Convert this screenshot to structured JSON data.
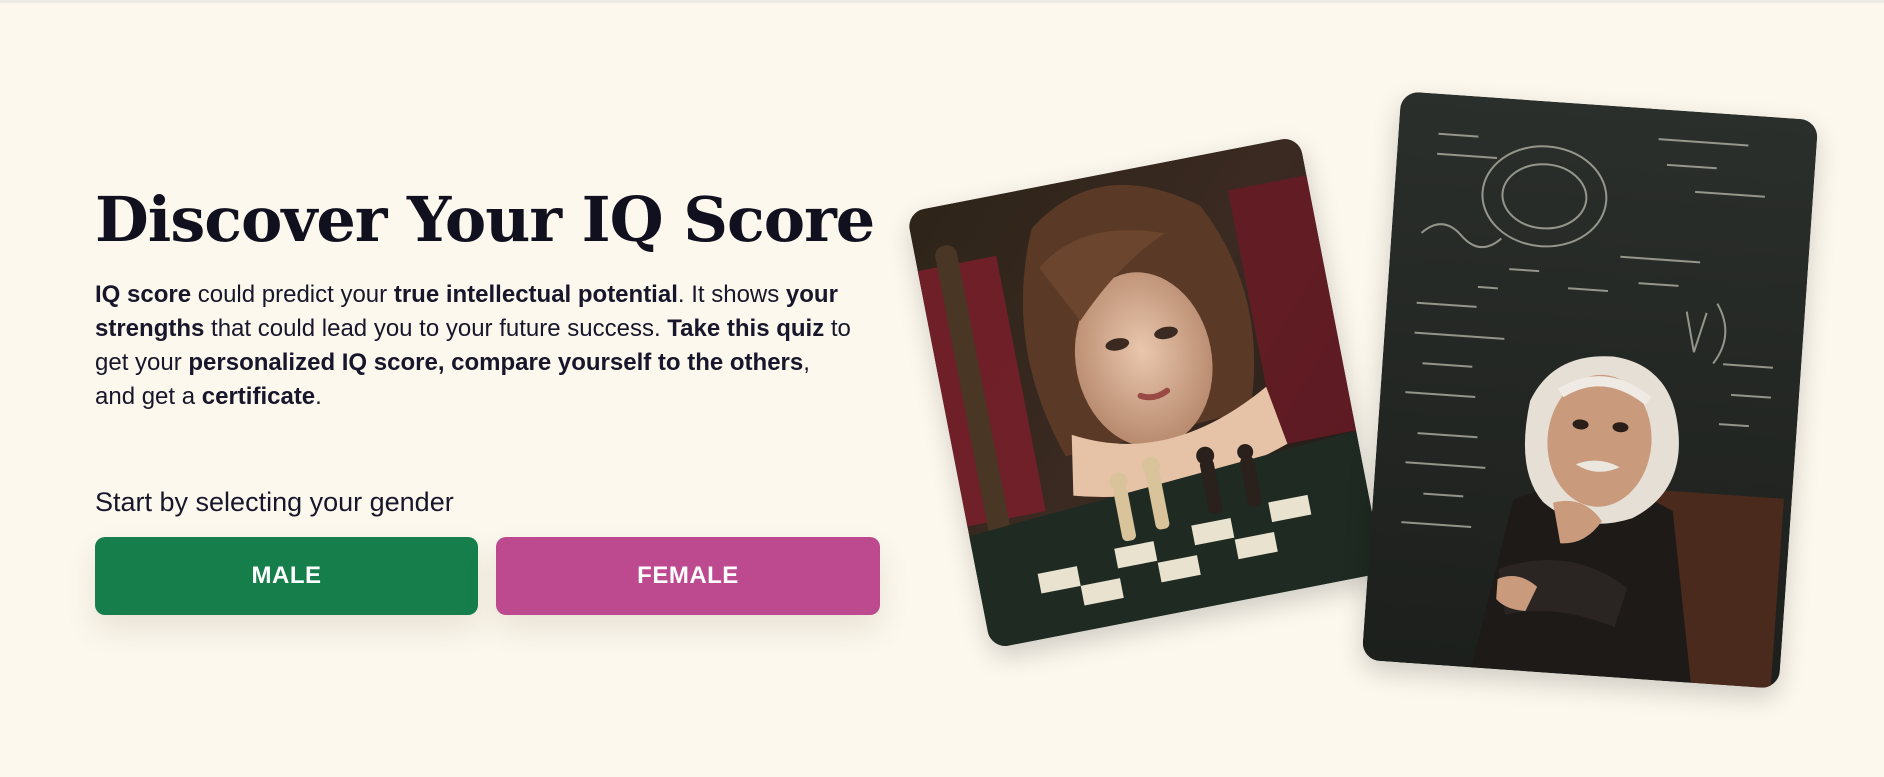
{
  "hero": {
    "title": "Discover Your IQ Score",
    "intro": [
      {
        "text": "IQ score",
        "bold": true
      },
      {
        "text": " could predict your ",
        "bold": false
      },
      {
        "text": "true intellectual potential",
        "bold": true
      },
      {
        "text": ". It shows ",
        "bold": false
      },
      {
        "text": "your strengths",
        "bold": true
      },
      {
        "text": " that could lead you to your future success. ",
        "bold": false
      },
      {
        "text": "Take this quiz",
        "bold": true
      },
      {
        "text": " to get your ",
        "bold": false
      },
      {
        "text": "personalized IQ score, compare yourself to the others",
        "bold": true
      },
      {
        "text": ", and get a ",
        "bold": false
      },
      {
        "text": "certificate",
        "bold": true
      },
      {
        "text": ".",
        "bold": false
      }
    ],
    "prompt": "Start by selecting your gender"
  },
  "buttons": {
    "male_label": "MALE",
    "female_label": "FEMALE"
  },
  "images": {
    "left": "woman-playing-chess-photo",
    "right": "scientist-at-chalkboard-photo"
  },
  "colors": {
    "background": "#fcf8ee",
    "male_button": "#157e4b",
    "female_button": "#bd4a8f",
    "text": "#11101f"
  }
}
